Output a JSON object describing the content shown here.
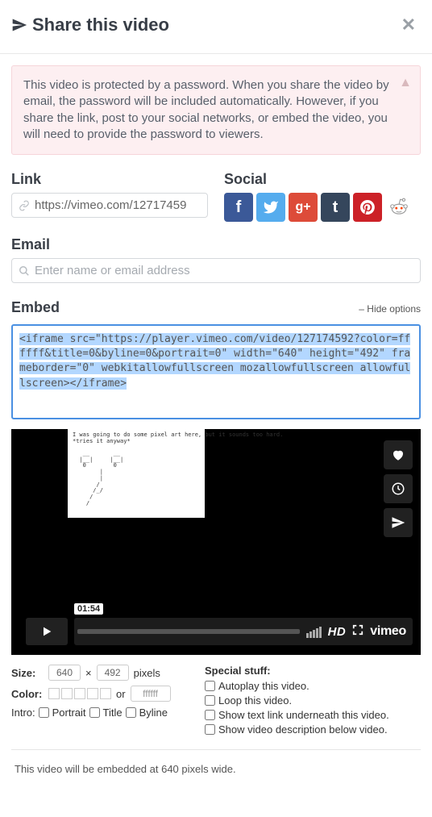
{
  "header": {
    "title": "Share this video"
  },
  "alert": {
    "text": "This video is protected by a password. When you share the video by email, the password will be included automatically. However, if you share the link, post to your social networks, or embed the video, you will need to provide the password to viewers."
  },
  "link": {
    "label": "Link",
    "value": "https://vimeo.com/12717459"
  },
  "social": {
    "label": "Social"
  },
  "email": {
    "label": "Email",
    "placeholder": "Enter name or email address"
  },
  "embed": {
    "label": "Embed",
    "hide_label": "– Hide options",
    "code": "<iframe src=\"https://player.vimeo.com/video/127174592?color=ffffff&title=0&byline=0&portrait=0\" width=\"640\" height=\"492\" frameborder=\"0\" webkitallowfullscreen mozallowfullscreen allowfullscreen></iframe>"
  },
  "preview": {
    "art_line1": "I was going to do some pixel art here, but it sounds too hard.",
    "art_line2": "*tries it anyway*",
    "duration": "01:54",
    "hd": "HD",
    "brand": "vimeo"
  },
  "options": {
    "size_label": "Size:",
    "width": "640",
    "times": "×",
    "height": "492",
    "pixels": "pixels",
    "color_label": "Color:",
    "or": "or",
    "hex": "ffffff",
    "intro_label": "Intro:",
    "portrait": "Portrait",
    "title": "Title",
    "byline": "Byline",
    "special_label": "Special stuff:",
    "autoplay": "Autoplay this video.",
    "loop": "Loop this video.",
    "textlink": "Show text link underneath this video.",
    "description": "Show video description below video."
  },
  "footnote": "This video will be embedded at 640 pixels wide."
}
